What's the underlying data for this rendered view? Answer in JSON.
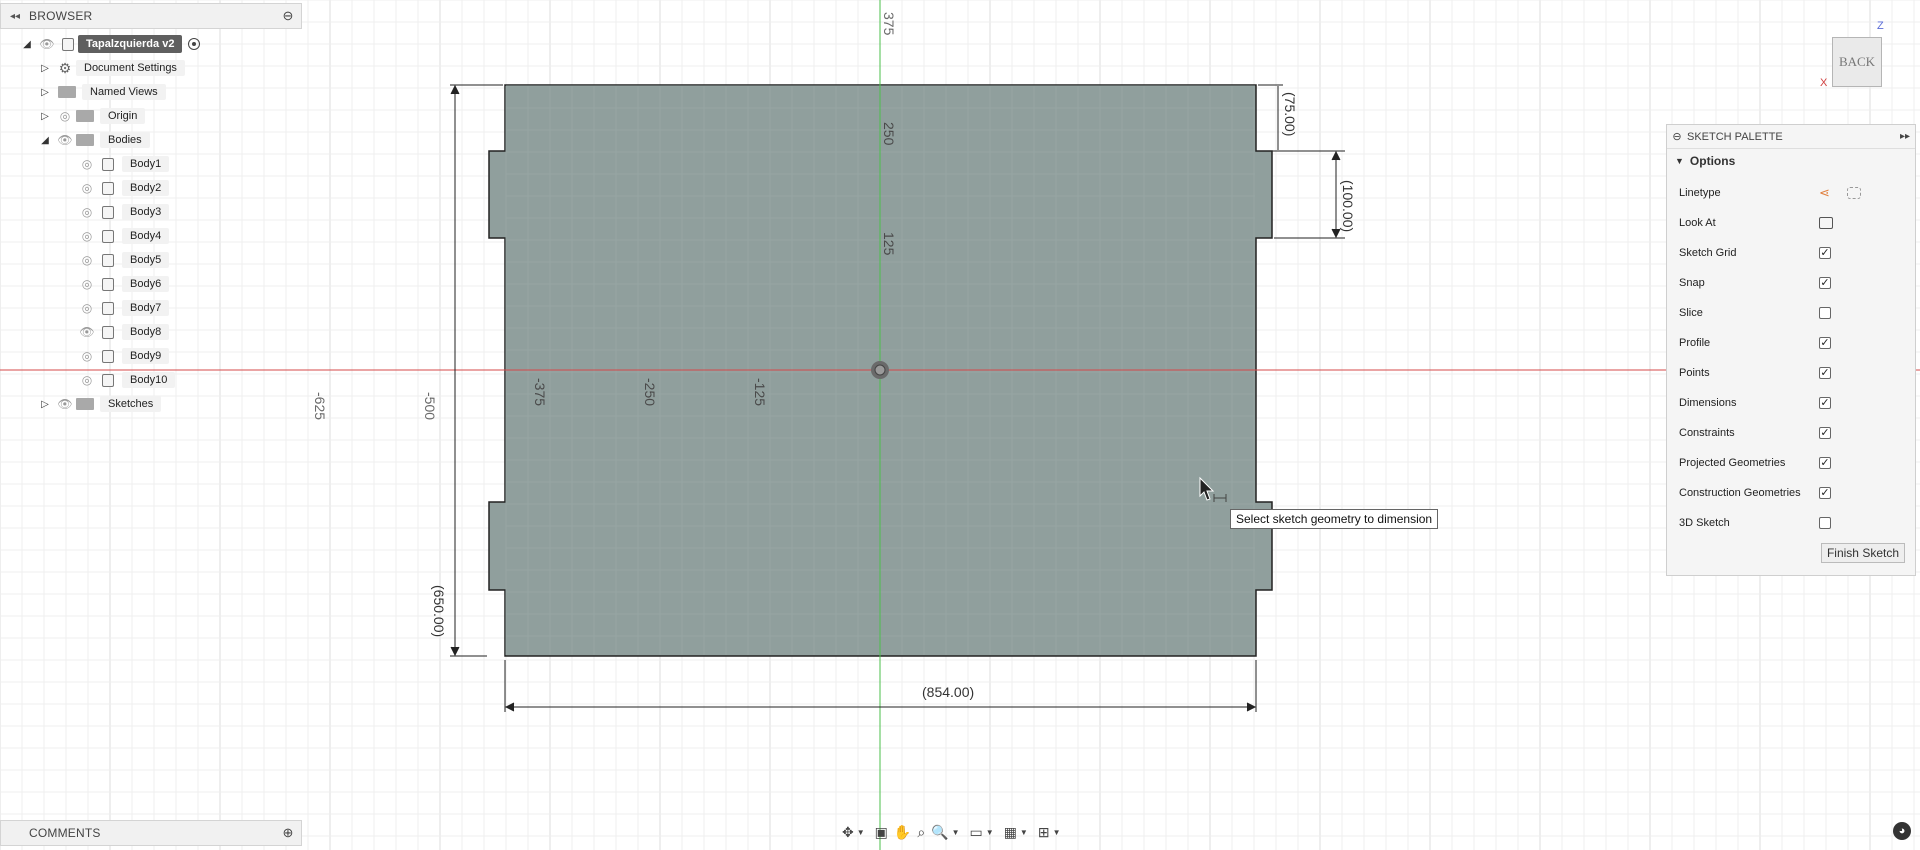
{
  "browser": {
    "title": "BROWSER",
    "root": "Tapalzquierda v2",
    "items": {
      "document_settings": "Document Settings",
      "named_views": "Named Views",
      "origin": "Origin",
      "bodies": "Bodies",
      "sketches": "Sketches"
    },
    "bodies": [
      "Body1",
      "Body2",
      "Body3",
      "Body4",
      "Body5",
      "Body6",
      "Body7",
      "Body8",
      "Body9",
      "Body10"
    ]
  },
  "comments": {
    "title": "COMMENTS"
  },
  "canvas": {
    "axis_labels": {
      "x_neg_625": "-625",
      "x_neg_500": "-500",
      "x_neg_375": "-375",
      "x_neg_250": "-250",
      "x_neg_125": "-125",
      "y_375": "375",
      "y_250": "250",
      "y_125": "125"
    },
    "dimensions": {
      "tab_height": "(75.00)",
      "notch_height": "(100.00)",
      "total_height": "(650.00)",
      "total_width": "(854.00)"
    },
    "colors": {
      "sketch_fill": "#8a9a98",
      "x_axis": "#d64a4a",
      "y_axis": "#4bbf4b",
      "grid": "#e7e7e7"
    }
  },
  "tooltip": "Select sketch geometry to dimension",
  "viewcube": {
    "face": "BACK",
    "z_label": "Z",
    "x_label": "X"
  },
  "palette": {
    "title": "SKETCH PALETTE",
    "section": "Options",
    "rows": [
      {
        "label": "Linetype"
      },
      {
        "label": "Look At"
      },
      {
        "label": "Sketch Grid",
        "checked": true
      },
      {
        "label": "Snap",
        "checked": true
      },
      {
        "label": "Slice",
        "checked": false
      },
      {
        "label": "Profile",
        "checked": true
      },
      {
        "label": "Points",
        "checked": true
      },
      {
        "label": "Dimensions",
        "checked": true
      },
      {
        "label": "Constraints",
        "checked": true
      },
      {
        "label": "Projected Geometries",
        "checked": true
      },
      {
        "label": "Construction Geometries",
        "checked": true
      },
      {
        "label": "3D Sketch",
        "checked": false
      }
    ],
    "finish_label": "Finish Sketch"
  },
  "toolbar": {
    "icons": [
      "orbit-icon",
      "look-at-icon",
      "pan-icon",
      "zoom-icon",
      "zoom-window-icon",
      "display-settings-icon",
      "grid-settings-icon",
      "viewports-icon"
    ]
  }
}
